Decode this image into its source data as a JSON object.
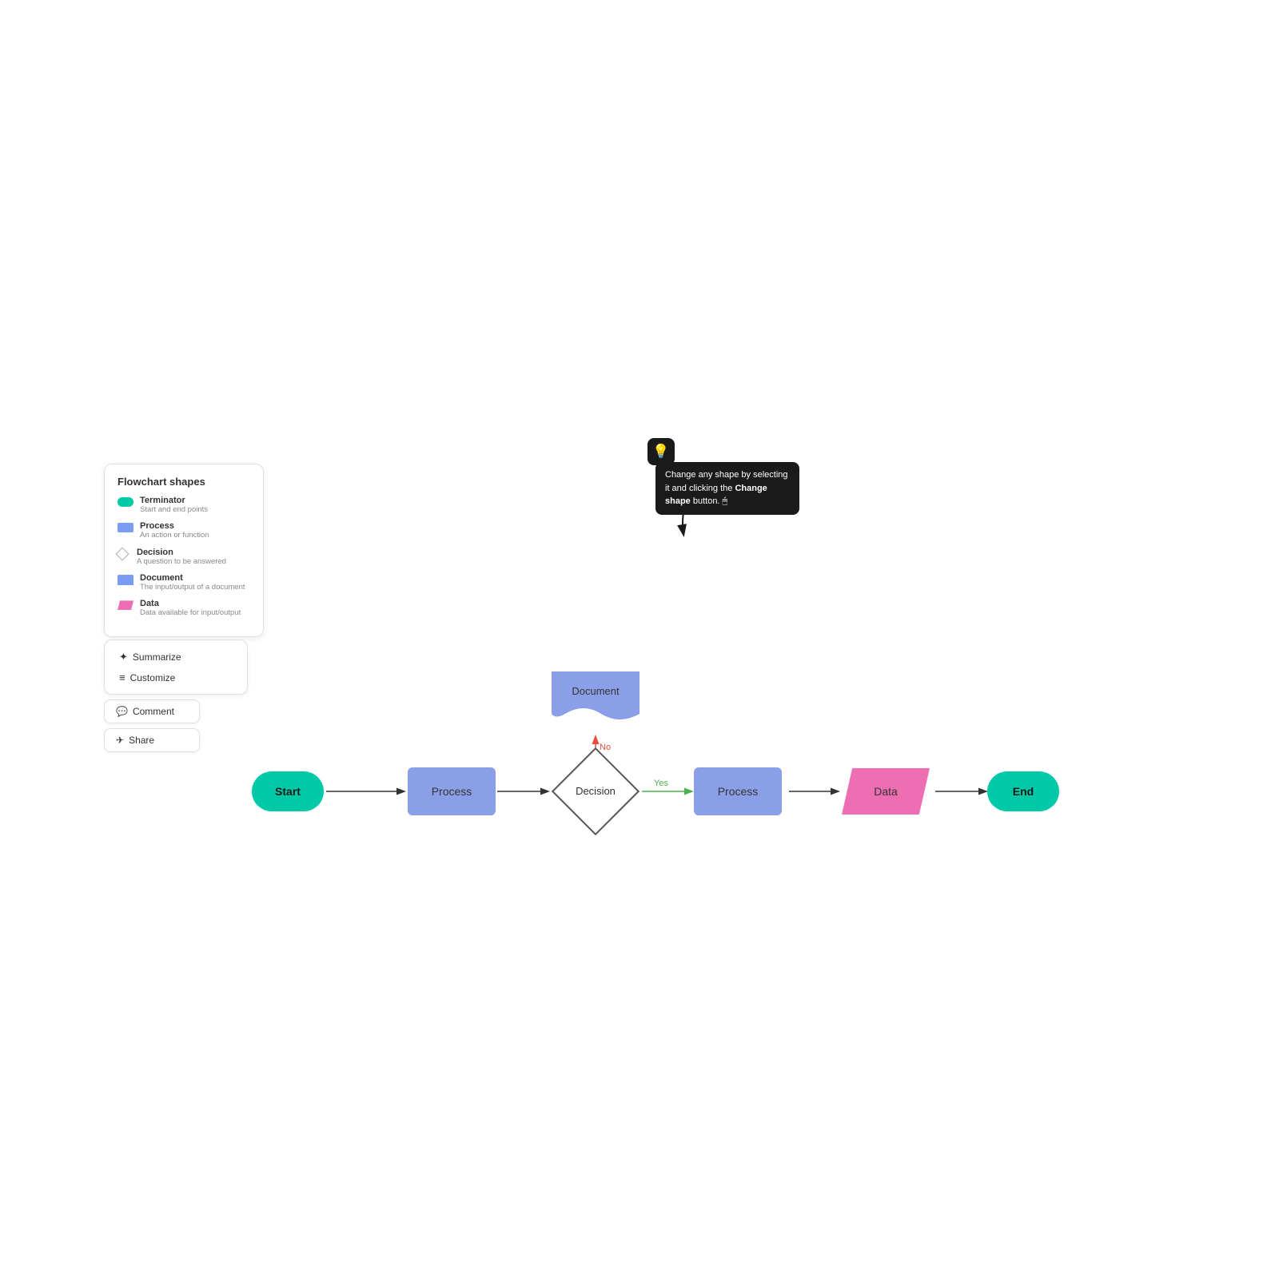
{
  "legend": {
    "title": "Flowchart shapes",
    "items": [
      {
        "type": "terminator",
        "label": "Terminator",
        "desc": "Start and end points"
      },
      {
        "type": "process",
        "label": "Process",
        "desc": "An action or function"
      },
      {
        "type": "decision",
        "label": "Decision",
        "desc": "A question to be answered"
      },
      {
        "type": "document",
        "label": "Document",
        "desc": "The input/output of a document"
      },
      {
        "type": "data",
        "label": "Data",
        "desc": "Data available for input/output"
      }
    ]
  },
  "actions": {
    "group1": [
      {
        "id": "summarize",
        "label": "Summarize",
        "icon": "✦"
      },
      {
        "id": "customize",
        "label": "Customize",
        "icon": "≡"
      }
    ],
    "comment": {
      "label": "Comment",
      "icon": "💬"
    },
    "share": {
      "label": "Share",
      "icon": "✈"
    }
  },
  "tooltip": {
    "text": "Change any shape by selecting it and clicking the ",
    "bold": "Change shape",
    "text2": " button."
  },
  "flowchart": {
    "nodes": [
      {
        "id": "start",
        "label": "Start",
        "type": "terminator"
      },
      {
        "id": "process1",
        "label": "Process",
        "type": "process"
      },
      {
        "id": "decision",
        "label": "Decision",
        "type": "decision"
      },
      {
        "id": "document",
        "label": "Document",
        "type": "document"
      },
      {
        "id": "process2",
        "label": "Process",
        "type": "process"
      },
      {
        "id": "data",
        "label": "Data",
        "type": "data"
      },
      {
        "id": "end",
        "label": "End",
        "type": "terminator"
      }
    ],
    "edges": [
      {
        "from": "start",
        "to": "process1",
        "label": ""
      },
      {
        "from": "process1",
        "to": "decision",
        "label": ""
      },
      {
        "from": "decision",
        "to": "document",
        "label": "No",
        "color": "red",
        "direction": "up"
      },
      {
        "from": "decision",
        "to": "process2",
        "label": "Yes",
        "color": "green"
      },
      {
        "from": "process2",
        "to": "data",
        "label": ""
      },
      {
        "from": "data",
        "to": "end",
        "label": ""
      }
    ]
  }
}
